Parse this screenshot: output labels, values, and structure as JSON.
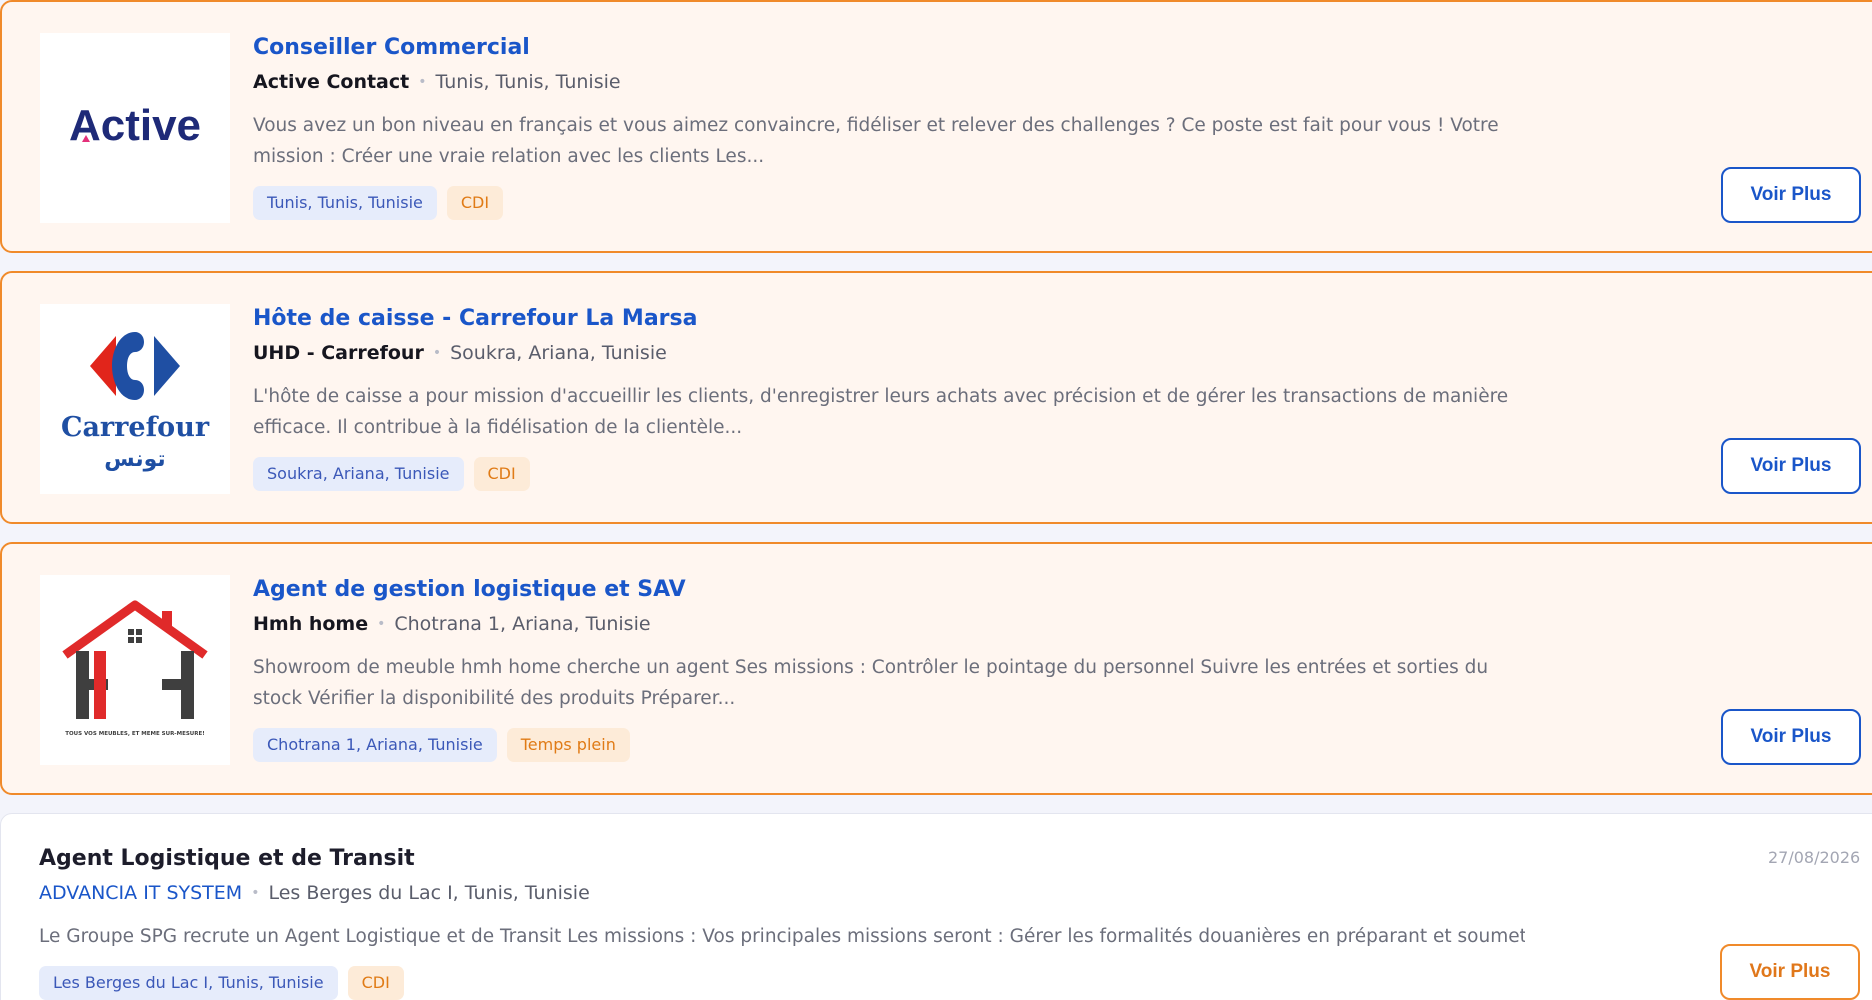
{
  "jobs": [
    {
      "title": "Conseiller Commercial",
      "company": "Active Contact",
      "location": "Tunis, Tunis, Tunisie",
      "description": "Vous avez un bon niveau en français et vous aimez convaincre, fidéliser et relever des challenges ?  Ce poste est fait pour vous ! Votre mission : Créer une vraie relation avec les clients  Les...",
      "tag_location": "Tunis, Tunis, Tunisie",
      "tag_type": "CDI",
      "button": "Voir Plus",
      "logo_text": "Active"
    },
    {
      "title": "Hôte de caisse - Carrefour La Marsa",
      "company": "UHD - Carrefour",
      "location": "Soukra, Ariana, Tunisie",
      "description": "L'hôte de caisse a pour mission d'accueillir les clients, d'enregistrer leurs achats avec précision et de gérer les transactions de manière efficace. Il contribue à la fidélisation de la clientèle...",
      "tag_location": "Soukra, Ariana, Tunisie",
      "tag_type": "CDI",
      "button": "Voir Plus",
      "logo_text": "Carrefour",
      "logo_subtext": "تونس"
    },
    {
      "title": "Agent de gestion logistique et SAV",
      "company": "Hmh home",
      "location": "Chotrana 1, Ariana, Tunisie",
      "description": "Showroom de meuble hmh home cherche un agent  Ses missions :   Contrôler le pointage du personnel Suivre les entrées et sorties du stock Vérifier la disponibilité des produits Préparer...",
      "tag_location": "Chotrana 1, Ariana, Tunisie",
      "tag_type": "Temps plein",
      "button": "Voir Plus",
      "logo_text": "HMH",
      "logo_subtext": "TOUS VOS MEUBLES, ET MEME SUR-MESURE!"
    },
    {
      "title": "Agent Logistique et de Transit",
      "company": "ADVANCIA IT SYSTEM",
      "location": "Les Berges du Lac I, Tunis, Tunisie",
      "description": "Le Groupe SPG recrute un Agent Logistique et de Transit Les missions : Vos principales missions seront : Gérer les formalités douanières en préparant et soumettant les documents...",
      "tag_location": "Les Berges du Lac I, Tunis, Tunisie",
      "tag_type": "CDI",
      "button": "Voir Plus",
      "date": "27/08/2026"
    }
  ],
  "colors": {
    "accent_blue": "#1a56c9",
    "accent_orange": "#f08a2a",
    "featured_bg": "#fff6f0",
    "carrefour_red": "#e1251b",
    "carrefour_blue": "#1f4fa3",
    "active_navy": "#1e2a78",
    "hmh_red": "#e02a2a"
  }
}
